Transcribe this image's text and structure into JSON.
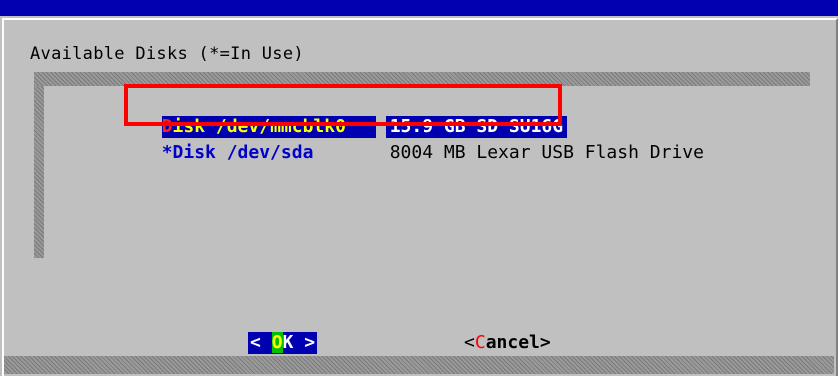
{
  "dialog": {
    "title": "Available Disks (*=In Use)"
  },
  "disks": [
    {
      "name_hotkey": "D",
      "name_rest": "isk /dev/mmcblk0",
      "description": "15.9 GB SD SU16G",
      "selected": true
    },
    {
      "name": "*Disk /dev/sda",
      "description": "8004 MB Lexar USB Flash Drive",
      "selected": false
    }
  ],
  "buttons": {
    "ok_left": "< ",
    "ok_hot": "O",
    "ok_rest": "K >",
    "cancel_left": "<",
    "cancel_hot": "C",
    "cancel_rest": "ancel>"
  },
  "colors": {
    "selection_bg": "#0000b0",
    "hotkey": "#ff2020",
    "annotation_box": "#ff0000",
    "dialog_bg": "#c0c0c0"
  }
}
